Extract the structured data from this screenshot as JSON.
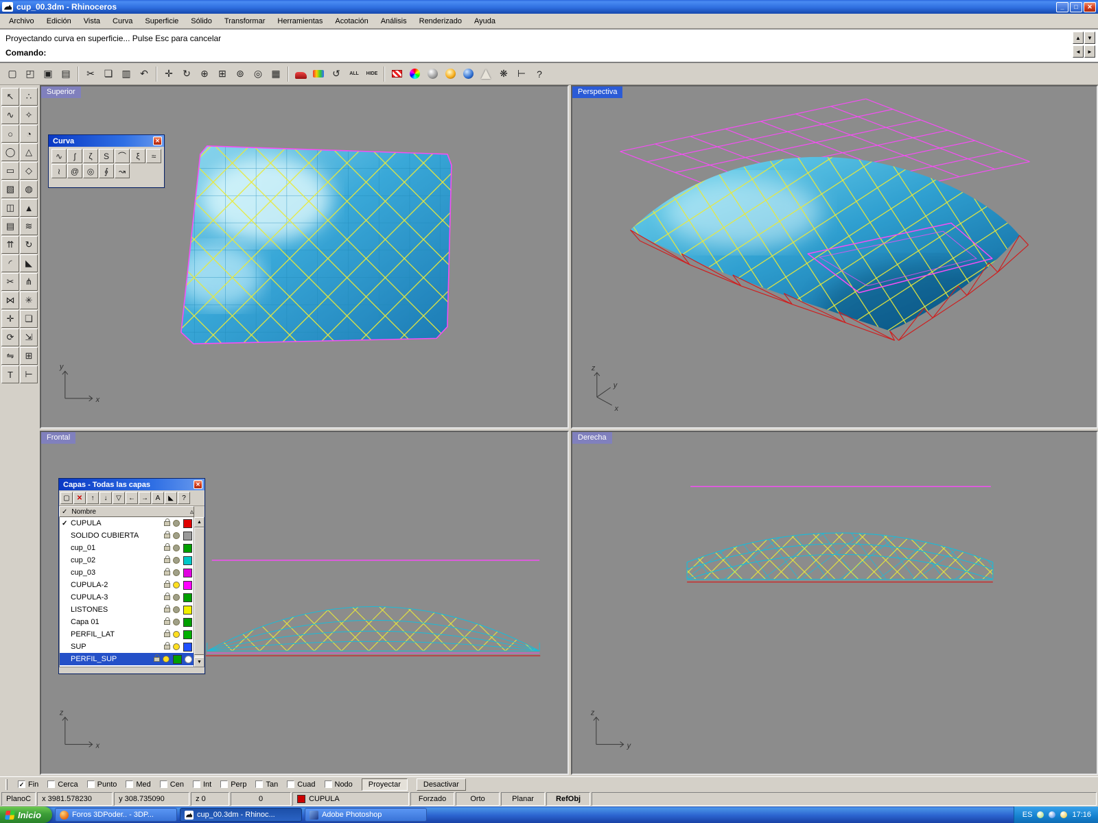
{
  "titlebar": {
    "title": "cup_00.3dm - Rhinoceros",
    "minimize": "_",
    "maximize": "□",
    "close": "✕"
  },
  "menubar": {
    "items": [
      "Archivo",
      "Edición",
      "Vista",
      "Curva",
      "Superficie",
      "Sólido",
      "Transformar",
      "Herramientas",
      "Acotación",
      "Análisis",
      "Renderizado",
      "Ayuda"
    ]
  },
  "command": {
    "history": "Proyectando curva en superficie... Pulse Esc para cancelar",
    "prompt": "Comando:",
    "spin_up": "▲",
    "spin_down": "▼",
    "prev": "◄",
    "next": "►"
  },
  "toolbar": {
    "icons": [
      {
        "name": "new-file",
        "glyph": "▢"
      },
      {
        "name": "open-file",
        "glyph": "◰"
      },
      {
        "name": "save-file",
        "glyph": "▣"
      },
      {
        "name": "print",
        "glyph": "▤"
      },
      {
        "name": "cut",
        "glyph": "✂"
      },
      {
        "name": "copy",
        "glyph": "❏"
      },
      {
        "name": "paste",
        "glyph": "▥"
      },
      {
        "name": "undo",
        "glyph": "↶"
      },
      {
        "name": "pan-view",
        "glyph": "✛"
      },
      {
        "name": "rotate-view",
        "glyph": "↻"
      },
      {
        "name": "zoom-dynamic",
        "glyph": "⊕"
      },
      {
        "name": "zoom-window",
        "glyph": "⊞"
      },
      {
        "name": "zoom-extents",
        "glyph": "⊚"
      },
      {
        "name": "zoom-selected",
        "glyph": "◎"
      },
      {
        "name": "grid-snap",
        "glyph": "▦"
      },
      {
        "name": "render-car",
        "glyph": ""
      },
      {
        "name": "render-preview",
        "glyph": ""
      },
      {
        "name": "spin-view",
        "glyph": "↺"
      },
      {
        "name": "select-all",
        "glyph": "ALL"
      },
      {
        "name": "hide-objects",
        "glyph": "HIDE"
      },
      {
        "name": "render-flag",
        "glyph": ""
      },
      {
        "name": "color-wheel",
        "glyph": ""
      },
      {
        "name": "shaded-sphere",
        "glyph": ""
      },
      {
        "name": "highlight-sphere",
        "glyph": ""
      },
      {
        "name": "blue-sphere",
        "glyph": ""
      },
      {
        "name": "cone-tool",
        "glyph": ""
      },
      {
        "name": "options-gear",
        "glyph": "❋"
      },
      {
        "name": "measure",
        "glyph": "⊢"
      },
      {
        "name": "help",
        "glyph": "?"
      }
    ]
  },
  "left_toolbar": {
    "icons": [
      {
        "name": "select",
        "glyph": "↖"
      },
      {
        "name": "points",
        "glyph": "∴"
      },
      {
        "name": "curve",
        "glyph": "∿"
      },
      {
        "name": "curve-cp",
        "glyph": "✧"
      },
      {
        "name": "circle",
        "glyph": "○"
      },
      {
        "name": "arc",
        "glyph": "◔"
      },
      {
        "name": "ellipse",
        "glyph": "◯"
      },
      {
        "name": "polyline",
        "glyph": "△"
      },
      {
        "name": "rectangle",
        "glyph": "▭"
      },
      {
        "name": "polygon",
        "glyph": "◇"
      },
      {
        "name": "box",
        "glyph": "▧"
      },
      {
        "name": "sphere",
        "glyph": "◍"
      },
      {
        "name": "cylinder",
        "glyph": "◫"
      },
      {
        "name": "cone",
        "glyph": "▲"
      },
      {
        "name": "surface",
        "glyph": "▤"
      },
      {
        "name": "loft",
        "glyph": "≋"
      },
      {
        "name": "extrude",
        "glyph": "⇈"
      },
      {
        "name": "revolve",
        "glyph": "↻"
      },
      {
        "name": "fillet",
        "glyph": "◜"
      },
      {
        "name": "chamfer",
        "glyph": "◣"
      },
      {
        "name": "trim",
        "glyph": "✂"
      },
      {
        "name": "split",
        "glyph": "⋔"
      },
      {
        "name": "join",
        "glyph": "⋈"
      },
      {
        "name": "explode",
        "glyph": "✳"
      },
      {
        "name": "move",
        "glyph": "✛"
      },
      {
        "name": "copy",
        "glyph": "❏"
      },
      {
        "name": "rotate",
        "glyph": "⟳"
      },
      {
        "name": "scale",
        "glyph": "⇲"
      },
      {
        "name": "mirror",
        "glyph": "⇋"
      },
      {
        "name": "array",
        "glyph": "⊞"
      },
      {
        "name": "text",
        "glyph": "T"
      },
      {
        "name": "dimension",
        "glyph": "⊢"
      }
    ]
  },
  "viewports": {
    "superior": {
      "label": "Superior"
    },
    "perspectiva": {
      "label": "Perspectiva"
    },
    "frontal": {
      "label": "Frontal"
    },
    "derecha": {
      "label": "Derecha"
    },
    "axis": {
      "x": "x",
      "y": "y",
      "z": "z"
    }
  },
  "curva_panel": {
    "title": "Curva",
    "close": "✕",
    "icons": [
      "∿",
      "ʃ",
      "ζ",
      "S",
      "⌒",
      "ξ",
      "≈",
      "≀",
      "@",
      "◎",
      "∮",
      "↝"
    ]
  },
  "layers_panel": {
    "title": "Capas - Todas las capas",
    "close": "✕",
    "tools": [
      {
        "name": "new-layer",
        "glyph": "▢"
      },
      {
        "name": "delete-layer",
        "glyph": "✕"
      },
      {
        "name": "move-up",
        "glyph": "↑"
      },
      {
        "name": "move-down",
        "glyph": "↓"
      },
      {
        "name": "filter",
        "glyph": "▽"
      },
      {
        "name": "collapse",
        "glyph": "←"
      },
      {
        "name": "expand",
        "glyph": "→"
      },
      {
        "name": "sort",
        "glyph": "A"
      },
      {
        "name": "options",
        "glyph": "◣"
      },
      {
        "name": "help",
        "glyph": "?"
      }
    ],
    "header": {
      "check": "✓",
      "name": "Nombre",
      "sort": "▵"
    },
    "scroll_up": "▲",
    "scroll_down": "▼",
    "layers": [
      {
        "name": "CUPULA",
        "mark": "✓",
        "color": "#e00000",
        "bulb": "#a0a088"
      },
      {
        "name": "SOLIDO CUBIERTA",
        "mark": "",
        "color": "#9a9a9a",
        "bulb": "#a0a088"
      },
      {
        "name": "cup_01",
        "mark": "",
        "color": "#00a000",
        "bulb": "#a0a088"
      },
      {
        "name": "cup_02",
        "mark": "",
        "color": "#00c8c8",
        "bulb": "#a0a088"
      },
      {
        "name": "cup_03",
        "mark": "",
        "color": "#e000e0",
        "bulb": "#a0a088"
      },
      {
        "name": "CUPULA-2",
        "mark": "",
        "color": "#ff00ff",
        "bulb": "#ffdf20"
      },
      {
        "name": "CUPULA-3",
        "mark": "",
        "color": "#00a000",
        "bulb": "#a0a088"
      },
      {
        "name": "LISTONES",
        "mark": "",
        "color": "#f0f000",
        "bulb": "#a0a088"
      },
      {
        "name": "Capa 01",
        "mark": "",
        "color": "#00a000",
        "bulb": "#a0a088"
      },
      {
        "name": "PERFIL_LAT",
        "mark": "",
        "color": "#00b000",
        "bulb": "#ffdf20"
      },
      {
        "name": "SUP",
        "mark": "",
        "color": "#2050ff",
        "bulb": "#ffdf20"
      },
      {
        "name": "PERFIL_SUP",
        "mark": "",
        "color": "#00a000",
        "bulb": "#ffdf20"
      }
    ]
  },
  "osnap": {
    "items": [
      {
        "label": "Fin",
        "mark": "✓"
      },
      {
        "label": "Cerca",
        "mark": ""
      },
      {
        "label": "Punto",
        "mark": ""
      },
      {
        "label": "Med",
        "mark": ""
      },
      {
        "label": "Cen",
        "mark": ""
      },
      {
        "label": "Int",
        "mark": ""
      },
      {
        "label": "Perp",
        "mark": ""
      },
      {
        "label": "Tan",
        "mark": ""
      },
      {
        "label": "Cuad",
        "mark": ""
      },
      {
        "label": "Nodo",
        "mark": ""
      }
    ],
    "project": "Proyectar",
    "disable": "Desactivar"
  },
  "statusbar": {
    "cplane": "PlanoC",
    "x": "x 3981.578230",
    "y": "y 308.735090",
    "z": "z 0",
    "delta": "0",
    "layer": "CUPULA",
    "layer_color": "#cc0000",
    "toggles": [
      "Forzado",
      "Orto",
      "Planar",
      "RefObj"
    ]
  },
  "taskbar": {
    "start": "Inicio",
    "tasks": [
      {
        "label": "Foros 3DPoder.. - 3DP..."
      },
      {
        "label": "cup_00.3dm - Rhinoc..."
      },
      {
        "label": "Adobe Photoshop"
      }
    ],
    "tray": {
      "lang": "ES",
      "time": "17:16"
    }
  }
}
